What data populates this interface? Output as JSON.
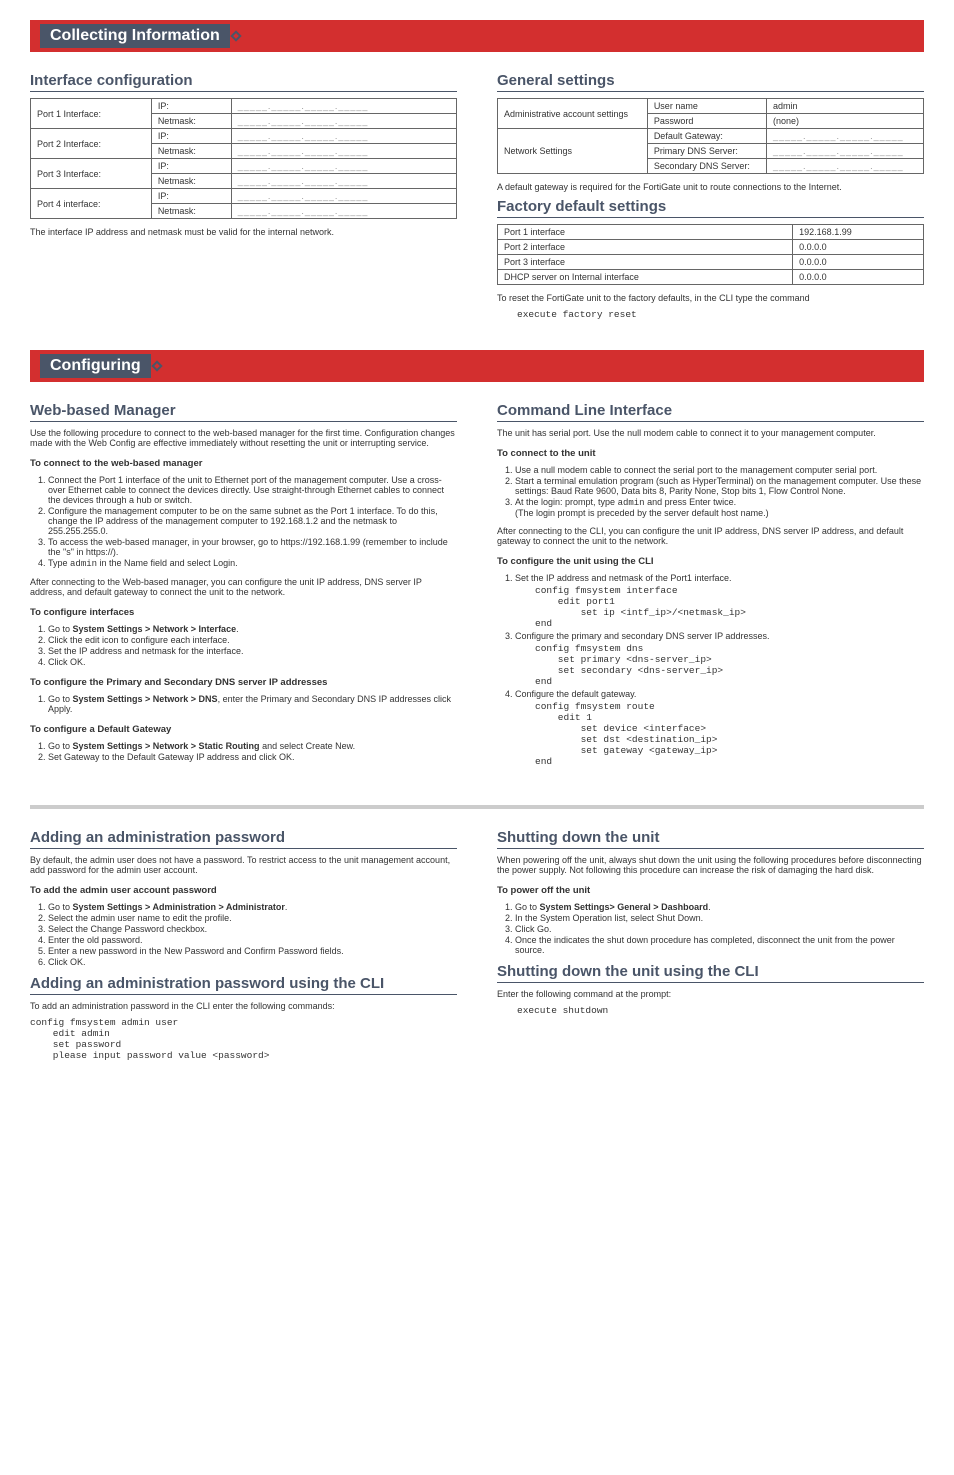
{
  "bar1": "Collecting Information",
  "bar2": "Configuring",
  "ifcfg": {
    "title": "Interface configuration",
    "rows": [
      {
        "port": "Port 1 Interface:",
        "k1": "IP:",
        "k2": "Netmask:"
      },
      {
        "port": "Port 2 Interface:",
        "k1": "IP:",
        "k2": "Netmask:"
      },
      {
        "port": "Port 3 Interface:",
        "k1": "IP:",
        "k2": "Netmask:"
      },
      {
        "port": "Port 4 interface:",
        "k1": "IP:",
        "k2": "Netmask:"
      }
    ],
    "fill": "_____._____._____._____",
    "note": "The interface IP address and netmask must be valid for the internal network."
  },
  "general": {
    "title": "General settings",
    "acct_label": "Administrative account settings",
    "user_label": "User name",
    "user_val": "admin",
    "pwd_label": "Password",
    "pwd_val": "(none)",
    "net_label": "Network Settings",
    "gw": "Default Gateway:",
    "p_dns": "Primary DNS Server:",
    "s_dns": "Secondary DNS Server:",
    "fill": "_____._____._____._____",
    "note": "A default gateway is required for the FortiGate unit to route connections to the Internet."
  },
  "factory": {
    "title": "Factory default settings",
    "rows": [
      [
        "Port 1 interface",
        "192.168.1.99"
      ],
      [
        "Port 2 interface",
        "0.0.0.0"
      ],
      [
        "Port 3 interface",
        "0.0.0.0"
      ],
      [
        "DHCP server on Internal interface",
        "0.0.0.0"
      ]
    ],
    "note": "To reset the FortiGate unit to the factory defaults, in the CLI type the command",
    "cmd": "execute factory reset"
  },
  "web": {
    "title": "Web-based Manager",
    "intro": "Use the following procedure to connect to the web-based manager for the first time. Configuration changes made with the Web Config are effective immediately without resetting the unit or interrupting service.",
    "h1": "To connect to the web-based manager",
    "s1_1": "Connect the Port 1 interface of the unit to Ethernet port of the management computer. Use a cross-over Ethernet cable to connect the devices directly. Use straight-through Ethernet cables to connect the devices through a hub or switch.",
    "s1_2": "Configure the management computer to be on the same subnet as the Port 1 interface. To do this, change the IP address of the management computer to 192.168.1.2 and the netmask to 255.255.255.0.",
    "s1_3": "To access the web-based manager, in your browser, go to https://192.168.1.99 (remember to include the \"s\" in https://).",
    "s1_4a": "Type ",
    "s1_4b": "admin",
    "s1_4c": " in the Name field and select Login.",
    "post1": "After connecting to the Web-based manager, you can configure the unit IP address, DNS server IP address, and default gateway to connect the unit to the network.",
    "h2": "To configure interfaces",
    "s2_1a": "Go to ",
    "s2_1b": "System Settings > Network > Interface",
    "s2_1c": ".",
    "s2_2": "Click the edit icon to configure each interface.",
    "s2_3": "Set the IP address and netmask for the interface.",
    "s2_4": "Click OK.",
    "h3": "To configure the Primary and Secondary DNS server IP addresses",
    "s3_1a": "Go to ",
    "s3_1b": "System Settings > Network > DNS",
    "s3_1c": ", enter the Primary and Secondary DNS IP addresses click Apply.",
    "h4": "To configure a Default Gateway",
    "s4_1a": "Go to ",
    "s4_1b": "System Settings > Network > Static Routing",
    "s4_1c": " and select Create New.",
    "s4_2": "Set Gateway to the Default Gateway IP address and click OK."
  },
  "cli": {
    "title": "Command Line Interface",
    "intro": "The unit has serial port. Use the null modem cable to connect it to your management computer.",
    "h1": "To connect to the unit",
    "s1_1": "Use a null modem cable to connect the serial port to the management computer serial port.",
    "s1_2": "Start a terminal emulation program (such as HyperTerminal) on the management computer. Use these settings: Baud Rate 9600, Data bits 8, Parity None, Stop bits 1, Flow Control None.",
    "s1_3a": "At the login: prompt, type ",
    "s1_3b": "admin",
    "s1_3c": " and press Enter twice.",
    "s1_3d": "(The login prompt is preceded by the server default host name.)",
    "post1": "After connecting to the CLI, you can configure the unit IP address, DNS server IP address, and default gateway to connect the unit to the network.",
    "h2": "To configure the unit using the CLI",
    "c1_label": "Set the IP address and netmask of the Port1 interface.",
    "c1_code": "config fmsystem interface\n    edit port1\n        set ip <intf_ip>/<netmask_ip>\nend",
    "c3_label": "Configure the primary and secondary DNS server IP addresses.",
    "c3_code": "config fmsystem dns\n    set primary <dns-server_ip>\n    set secondary <dns-server_ip>\nend",
    "c4_label": "Configure the default gateway.",
    "c4_code": "config fmsystem route\n    edit 1\n        set device <interface>\n        set dst <destination_ip>\n        set gateway <gateway_ip>\nend"
  },
  "admin": {
    "title": "Adding an administration password",
    "intro": "By default, the admin user does not have a password. To restrict access to the unit management account, add password for the admin user account.",
    "h1": "To add the admin user account password",
    "s1a": "Go to ",
    "s1b": "System Settings > Administration > Administrator",
    "s1c": ".",
    "s2": "Select the admin user name to edit the profile.",
    "s3": "Select the Change Password checkbox.",
    "s4": "Enter the old password.",
    "s5": "Enter a new password in the New Password and Confirm Password fields.",
    "s6": "Click OK.",
    "title2": "Adding an administration password using the CLI",
    "intro2": "To add an administration password in the CLI enter the following commands:",
    "code": "config fmsystem admin user\n    edit admin\n    set password\n    please input password value <password>"
  },
  "shut": {
    "title": "Shutting down the unit",
    "intro": "When powering off the unit, always shut down the unit using the following procedures before disconnecting the power supply. Not following this procedure can increase the risk of damaging the hard disk.",
    "h1": "To power off the unit",
    "s1a": "Go to ",
    "s1b": "System Settings> General > Dashboard",
    "s1c": ".",
    "s2": "In the System Operation list, select Shut Down.",
    "s3": "Click Go.",
    "s4": "Once the indicates the shut down procedure has completed, disconnect the unit from the power source.",
    "title2": "Shutting down the unit using the CLI",
    "intro2": "Enter the following command at the prompt:",
    "code": "execute shutdown"
  }
}
